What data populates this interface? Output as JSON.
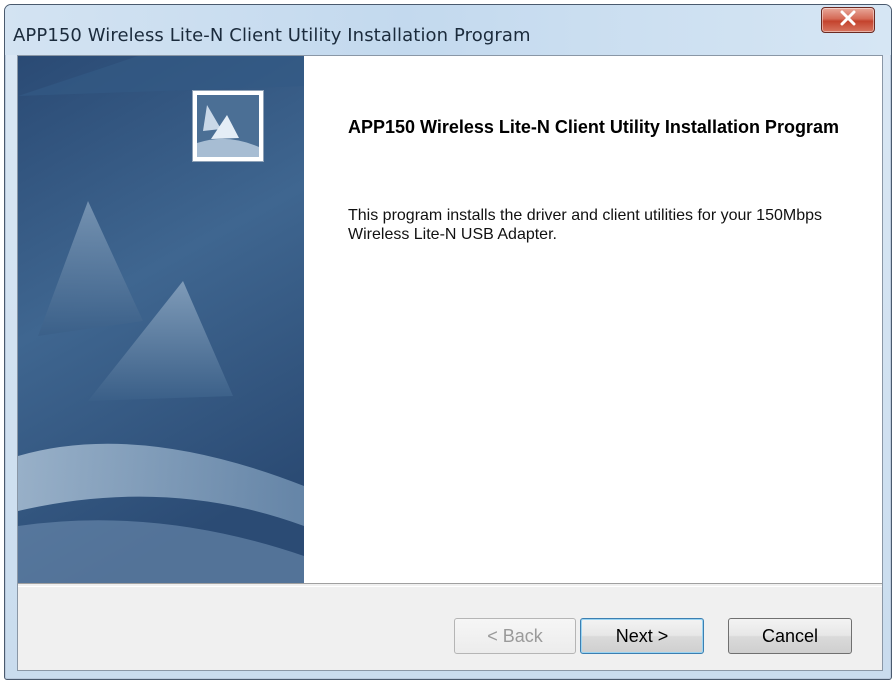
{
  "window": {
    "title": "APP150 Wireless Lite-N Client Utility Installation Program"
  },
  "content": {
    "heading": "APP150 Wireless Lite-N Client Utility Installation Program",
    "description": "This program installs the driver and client utilities for your 150Mbps Wireless Lite-N USB Adapter."
  },
  "buttons": {
    "back": {
      "label": "< Back",
      "enabled": false
    },
    "next": {
      "label": "Next >",
      "enabled": true
    },
    "cancel": {
      "label": "Cancel",
      "enabled": true
    }
  },
  "icons": {
    "close": "close-icon",
    "logo": "installer-logo-icon"
  },
  "colors": {
    "banner": "#2d4e77",
    "close_button": "#c3432d",
    "dialog_face": "#f0f0f0"
  }
}
